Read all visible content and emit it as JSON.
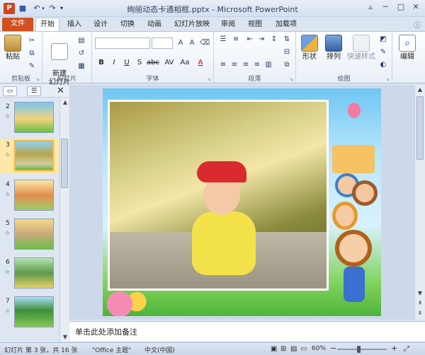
{
  "window": {
    "title": "绚丽动态卡通相框.pptx - Microsoft PowerPoint",
    "controls": {
      "minimize": "─",
      "maximize": "□",
      "close": "✕"
    }
  },
  "quick_access": {
    "logo": "P",
    "save": "■",
    "undo": "↶",
    "redo": "↷",
    "dropdown": "▾"
  },
  "tabs": [
    "文件",
    "开始",
    "插入",
    "设计",
    "切换",
    "动画",
    "幻灯片放映",
    "审阅",
    "视图",
    "加载项"
  ],
  "ribbon": {
    "clipboard": {
      "paste": "粘贴",
      "group": "剪贴板"
    },
    "slides": {
      "new_slide": "新建\n幻灯片",
      "group": "幻灯片"
    },
    "font": {
      "group": "字体",
      "buttons": [
        "B",
        "I",
        "U",
        "S",
        "abc",
        "AV",
        "Aa",
        "A"
      ]
    },
    "paragraph": {
      "group": "段落"
    },
    "drawing": {
      "shape": "形状",
      "arrange": "排列",
      "quick_style": "快速样式",
      "group": "绘图"
    },
    "editing": {
      "label": "编辑"
    }
  },
  "slides_panel": {
    "thumbs": [
      {
        "num": "2",
        "star": "☆"
      },
      {
        "num": "3",
        "star": "☆"
      },
      {
        "num": "4",
        "star": "☆"
      },
      {
        "num": "5",
        "star": "☆"
      },
      {
        "num": "6",
        "star": "☆"
      },
      {
        "num": "7",
        "star": "☆"
      }
    ],
    "selected": "3"
  },
  "notes": {
    "placeholder": "单击此处添加备注"
  },
  "status": {
    "slide_info": "幻灯片 第 3 张，共 16 张",
    "theme": "\"Office 主题\"",
    "language": "中文(中国)",
    "zoom": "60%",
    "zoom_minus": "−",
    "zoom_plus": "+"
  },
  "colors": {
    "file_tab": "#d3501f",
    "selected_thumb": "#e8b84a"
  }
}
